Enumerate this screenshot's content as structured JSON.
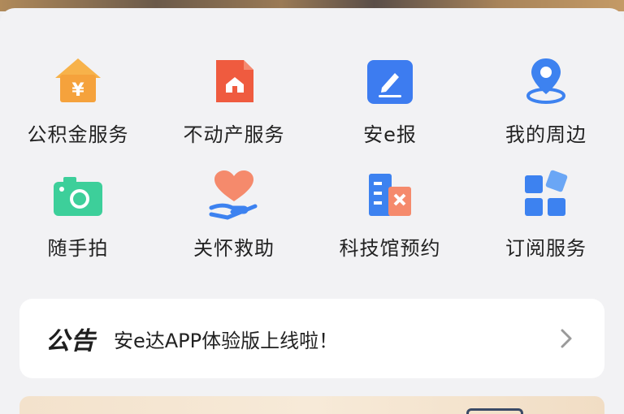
{
  "services": [
    {
      "label": "公积金服务",
      "icon": "house-yuan-icon",
      "color": "#f5a23c"
    },
    {
      "label": "不动产服务",
      "icon": "property-doc-icon",
      "color": "#ef5b3f"
    },
    {
      "label": "安e报",
      "icon": "edit-report-icon",
      "color": "#3d7cf0"
    },
    {
      "label": "我的周边",
      "icon": "location-pin-icon",
      "color": "#3d82f0"
    },
    {
      "label": "随手拍",
      "icon": "camera-icon",
      "color": "#3dcf9a"
    },
    {
      "label": "关怀救助",
      "icon": "heart-hand-icon",
      "color": "#f07a5c"
    },
    {
      "label": "科技馆预约",
      "icon": "building-booking-icon",
      "color": "#3d82f0"
    },
    {
      "label": "订阅服务",
      "icon": "subscribe-blocks-icon",
      "color": "#3d82f0"
    }
  ],
  "notice": {
    "logo": "公告",
    "text": "安e达APP体验版上线啦！",
    "chevron_icon": "chevron-right-icon"
  }
}
